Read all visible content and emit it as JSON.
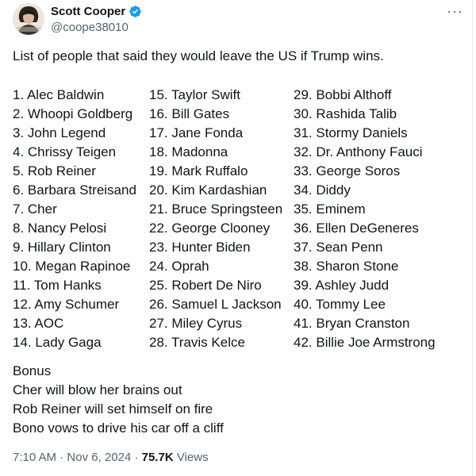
{
  "author": {
    "name": "Scott Cooper",
    "handle": "@coope38010",
    "verified_color": "#1d9bf0"
  },
  "icons": [
    "avatar-photo",
    "verified-badge-icon",
    "more-options-icon"
  ],
  "tweet": {
    "text": "List of people that said they would leave the US if Trump wins.",
    "list_col1": [
      "1. Alec Baldwin",
      "2. Whoopi Goldberg",
      "3. John Legend",
      "4. Chrissy Teigen",
      "5. Rob Reiner",
      "6. Barbara Streisand",
      "7. Cher",
      "8. Nancy Pelosi",
      "9. Hillary Clinton",
      "10. Megan Rapinoe",
      "11. Tom Hanks",
      "12. Amy Schumer",
      "13. AOC",
      "14. Lady Gaga"
    ],
    "list_col2": [
      "15. Taylor Swift",
      "16. Bill Gates",
      "17. Jane Fonda",
      "18. Madonna",
      "19. Mark Ruffalo",
      "20. Kim Kardashian",
      "21. Bruce Springsteen",
      "22. George Clooney",
      "23. Hunter Biden",
      "24. Oprah",
      "25. Robert De Niro",
      "26. Samuel L Jackson",
      "27. Miley Cyrus",
      "28. Travis Kelce"
    ],
    "list_col3": [
      "29. Bobbi Althoff",
      "30. Rashida Talib",
      "31. Stormy Daniels",
      "32. Dr. Anthony Fauci",
      "33. George Soros",
      "34. Diddy",
      "35. Eminem",
      "36. Ellen DeGeneres",
      "37. Sean Penn",
      "38. Sharon Stone",
      "39. Ashley Judd",
      "40. Tommy Lee",
      "41. Bryan Cranston",
      "42. Billie Joe Armstrong"
    ],
    "bonus": [
      "Bonus",
      "Cher will blow her brains out",
      "Rob Reiner will set himself on fire",
      "Bono vows to drive his car off a cliff"
    ]
  },
  "meta": {
    "time": "7:10 AM",
    "separator": "·",
    "date": "Nov 6, 2024",
    "views_count": "75.7K",
    "views_label": "Views"
  }
}
